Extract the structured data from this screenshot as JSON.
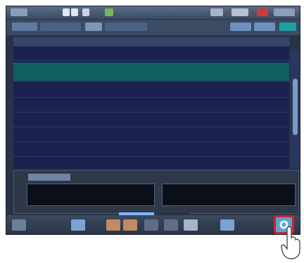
{
  "topbar": {
    "items": [
      "",
      "",
      "",
      "",
      "",
      "",
      ""
    ]
  },
  "tabs": [
    "",
    "",
    "",
    ""
  ],
  "grid": {
    "headers": [
      "",
      "",
      "",
      "",
      "",
      "",
      "",
      ""
    ],
    "rows": [
      [
        "",
        "",
        "",
        "",
        "",
        "",
        "",
        ""
      ],
      [
        "",
        "",
        "",
        "",
        "",
        "",
        "",
        ""
      ],
      [
        "",
        "",
        "",
        "",
        "",
        "",
        "",
        ""
      ],
      [
        "",
        "",
        "",
        "",
        "",
        "",
        "",
        ""
      ],
      [
        "",
        "",
        "",
        "",
        "",
        "",
        "",
        ""
      ],
      [
        "",
        "",
        "",
        "",
        "",
        "",
        "",
        ""
      ],
      [
        "",
        "",
        "",
        "",
        "",
        "",
        "",
        ""
      ],
      [
        "",
        "",
        "",
        "",
        "",
        "",
        "",
        ""
      ]
    ]
  },
  "detail": {
    "label": "",
    "left_lines": [
      "",
      ""
    ],
    "right_lines": [
      "",
      ""
    ]
  },
  "progress": {
    "fraction": 0.5
  },
  "bottom": {
    "buttons": [
      "",
      "",
      "",
      "",
      "",
      "",
      "",
      ""
    ],
    "exit_icon": "gear-icon"
  },
  "colors": {
    "selected_row": "#0f5f60",
    "highlight": "#d71e2a",
    "grid_bg": "#1c2250"
  }
}
